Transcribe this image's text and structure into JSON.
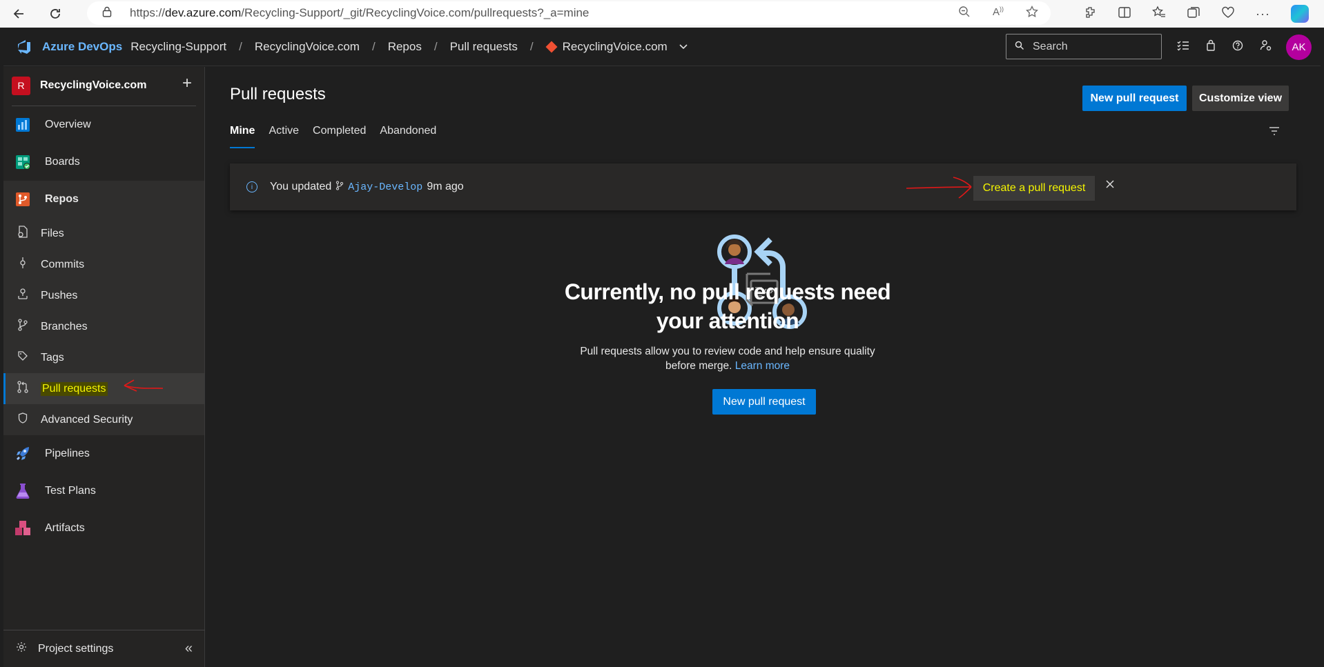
{
  "browser": {
    "url_prefix": "https://",
    "url_host": "dev.azure.com",
    "url_path": "/Recycling-Support/_git/RecyclingVoice.com/pullrequests?_a=mine"
  },
  "header": {
    "brand": "Azure DevOps",
    "breadcrumbs": [
      "Recycling-Support",
      "RecyclingVoice.com",
      "Repos",
      "Pull requests"
    ],
    "repo_selector": "RecyclingVoice.com",
    "search_placeholder": "Search",
    "avatar_initials": "AK"
  },
  "sidebar": {
    "project_initial": "R",
    "project_name": "RecyclingVoice.com",
    "items": [
      {
        "label": "Overview",
        "icon": "overview-icon",
        "color": "#0078d4"
      },
      {
        "label": "Boards",
        "icon": "boards-icon",
        "color": "#009c7c"
      },
      {
        "label": "Repos",
        "icon": "repos-icon",
        "color": "#e05a2a"
      }
    ],
    "repo_subitems": [
      {
        "label": "Files",
        "icon": "files-icon"
      },
      {
        "label": "Commits",
        "icon": "commits-icon"
      },
      {
        "label": "Pushes",
        "icon": "pushes-icon"
      },
      {
        "label": "Branches",
        "icon": "branches-icon"
      },
      {
        "label": "Tags",
        "icon": "tags-icon"
      },
      {
        "label": "Pull requests",
        "icon": "pull-request-icon"
      },
      {
        "label": "Advanced Security",
        "icon": "shield-icon"
      }
    ],
    "items_after": [
      {
        "label": "Pipelines",
        "icon": "pipelines-icon",
        "color": "#3b7bd8"
      },
      {
        "label": "Test Plans",
        "icon": "test-plans-icon",
        "color": "#8a4fcf"
      },
      {
        "label": "Artifacts",
        "icon": "artifacts-icon",
        "color": "#c23b6b"
      }
    ],
    "footer_label": "Project settings"
  },
  "main": {
    "title": "Pull requests",
    "new_pr_label": "New pull request",
    "customize_label": "Customize view",
    "tabs": [
      "Mine",
      "Active",
      "Completed",
      "Abandoned"
    ],
    "banner": {
      "prefix": "You updated",
      "branch": "Ajay-Develop",
      "suffix": "9m ago",
      "create_label": "Create a pull request"
    },
    "empty": {
      "title": "Currently, no pull requests need your attention",
      "description": "Pull requests allow you to review code and help ensure quality before merge.",
      "learn_more": "Learn more",
      "button_label": "New pull request"
    }
  }
}
